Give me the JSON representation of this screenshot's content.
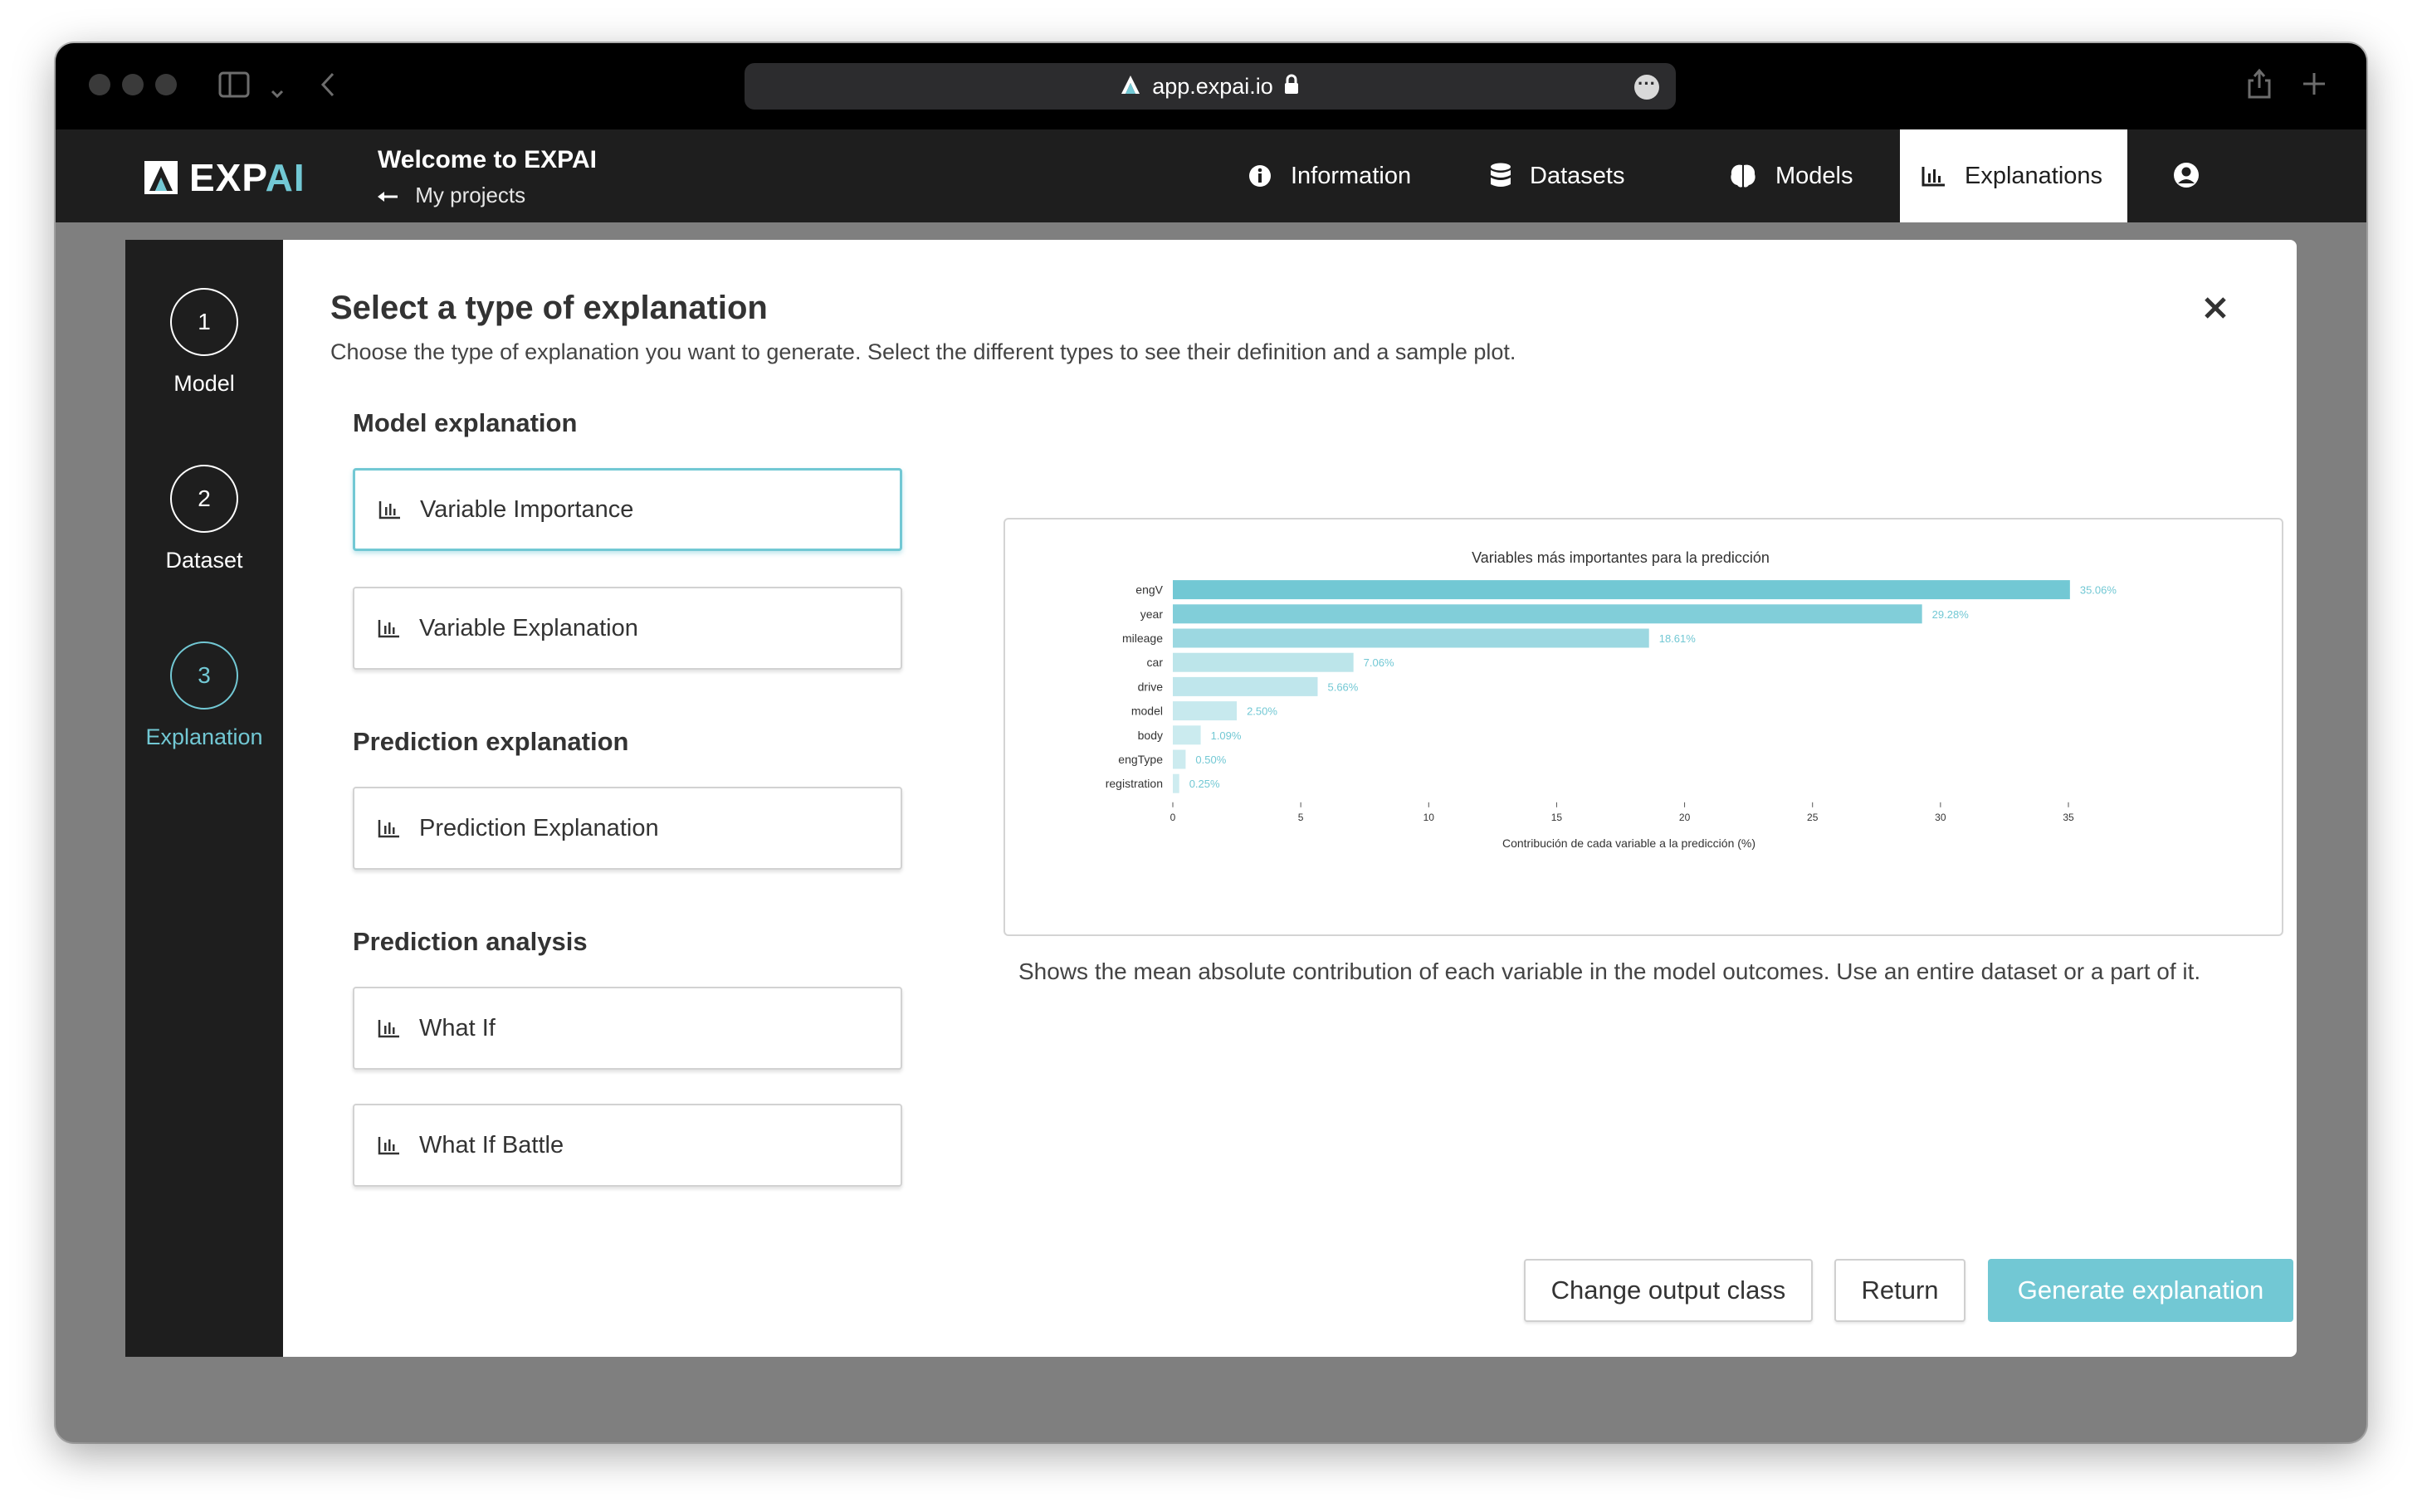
{
  "browser": {
    "url": "app.expai.io"
  },
  "header": {
    "logo_left": "EXP",
    "logo_accent": "AI",
    "welcome_title": "Welcome to EXPAI",
    "back_link": "My projects",
    "nav": [
      {
        "label": "Information",
        "icon": "info-icon"
      },
      {
        "label": "Datasets",
        "icon": "database-icon"
      },
      {
        "label": "Models",
        "icon": "brain-icon"
      },
      {
        "label": "Explanations",
        "icon": "bar-chart-icon",
        "active": true
      }
    ]
  },
  "stepper": [
    {
      "number": "1",
      "label": "Model"
    },
    {
      "number": "2",
      "label": "Dataset"
    },
    {
      "number": "3",
      "label": "Explanation",
      "active": true
    }
  ],
  "modal": {
    "title": "Select a type of explanation",
    "subtitle": "Choose the type of explanation you want to generate. Select the different types to see their definition and a sample plot.",
    "sections": [
      {
        "title": "Model explanation",
        "options": [
          "Variable Importance",
          "Variable Explanation"
        ]
      },
      {
        "title": "Prediction explanation",
        "options": [
          "Prediction Explanation"
        ]
      },
      {
        "title": "Prediction analysis",
        "options": [
          "What If",
          "What If Battle"
        ]
      }
    ],
    "selected_option": "Variable Importance",
    "description": "Shows the mean absolute contribution of each variable in the model outcomes. Use an entire dataset or a part of it.",
    "buttons": {
      "change_class": "Change output class",
      "return": "Return",
      "generate": "Generate explanation"
    }
  },
  "colors": {
    "accent": "#72c8d4",
    "header_bg": "#1e1e1e",
    "backdrop": "#7f7f7f"
  },
  "chart_data": {
    "type": "bar",
    "orientation": "horizontal",
    "title": "Variables más importantes para la predicción",
    "xlabel": "Contribución de cada variable a la predicción (%)",
    "ylabel": "",
    "categories": [
      "engV",
      "year",
      "mileage",
      "car",
      "drive",
      "model",
      "body",
      "engType",
      "registration"
    ],
    "values": [
      35.06,
      29.28,
      18.61,
      7.06,
      5.66,
      2.5,
      1.09,
      0.5,
      0.25
    ],
    "value_labels": [
      "35.06%",
      "29.28%",
      "18.61%",
      "7.06%",
      "5.66%",
      "2.50%",
      "1.09%",
      "0.50%",
      "0.25%"
    ],
    "xticks": [
      0,
      5,
      10,
      15,
      20,
      25,
      30,
      35
    ],
    "xlim": [
      0,
      35
    ],
    "grid": false,
    "bar_color": "#72c8d4"
  }
}
